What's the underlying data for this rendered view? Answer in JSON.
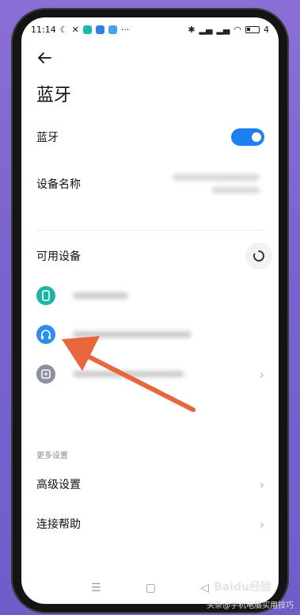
{
  "status_bar": {
    "time": "11:14",
    "more": "···",
    "battery": "4"
  },
  "page": {
    "title": "蓝牙"
  },
  "bluetooth_row": {
    "label": "蓝牙",
    "enabled": true
  },
  "device_name_row": {
    "label": "设备名称",
    "value_line1": "",
    "value_line2": ""
  },
  "available_section": {
    "label": "可用设备"
  },
  "devices": [
    {
      "name": "",
      "icon": "phone-icon",
      "color": "#1cb5a6"
    },
    {
      "name": "",
      "icon": "headphones-icon",
      "color": "#2d8ef0"
    },
    {
      "name": "",
      "icon": "device-icon",
      "color": "#8b90a3"
    }
  ],
  "more_settings": {
    "caption": "更多设置",
    "advanced": "高级设置",
    "help": "连接帮助"
  },
  "watermark": {
    "logo": "Baidu经验",
    "text": "头条@手机电脑实用技巧"
  },
  "colors": {
    "accent": "#1e7ff2",
    "arrow": "#e8663b",
    "background": "#7b63cf"
  }
}
